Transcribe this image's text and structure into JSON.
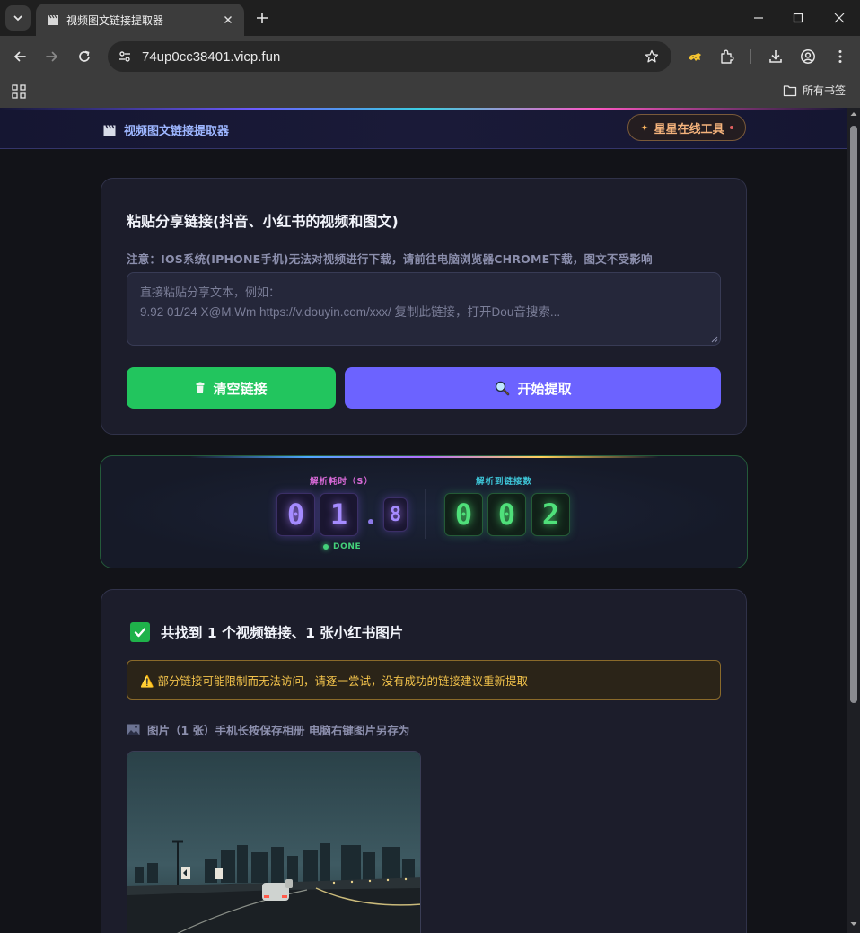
{
  "browser": {
    "tab_title": "视频图文链接提取器",
    "url": "74up0cc38401.vicp.fun",
    "bookmarks_all": "所有书签"
  },
  "header": {
    "brand": "视频图文链接提取器",
    "badge": "星星在线工具"
  },
  "input_card": {
    "title": "粘贴分享链接(抖音、小红书的视频和图文)",
    "notice": "注意：IOS系统(IPHONE手机)无法对视频进行下载，请前往电脑浏览器CHROME下载，图文不受影响",
    "placeholder_line1": "直接粘贴分享文本，例如：",
    "placeholder_line2": "9.92 01/24 X@M.Wm https://v.douyin.com/xxx/ 复制此链接，打开Dou音搜索...",
    "clear_button": "清空链接",
    "extract_button": "开始提取"
  },
  "timer": {
    "time_label": "解析耗时（S）",
    "count_label": "解析到链接数",
    "time_digits": [
      "0",
      "1",
      "8"
    ],
    "count_digits": [
      "0",
      "0",
      "2"
    ],
    "status": "DONE"
  },
  "result": {
    "summary": "共找到 1 个视频链接、1 张小红书图片",
    "warning": "⚠️ 部分链接可能限制而无法访问，请逐一尝试，没有成功的链接建议重新提取",
    "images_label": "图片（1 张）手机长按保存相册 电脑右键图片另存为"
  },
  "colors": {
    "accent_purple": "#6c63ff",
    "accent_green": "#22c55e",
    "warning": "#f2c24b"
  }
}
